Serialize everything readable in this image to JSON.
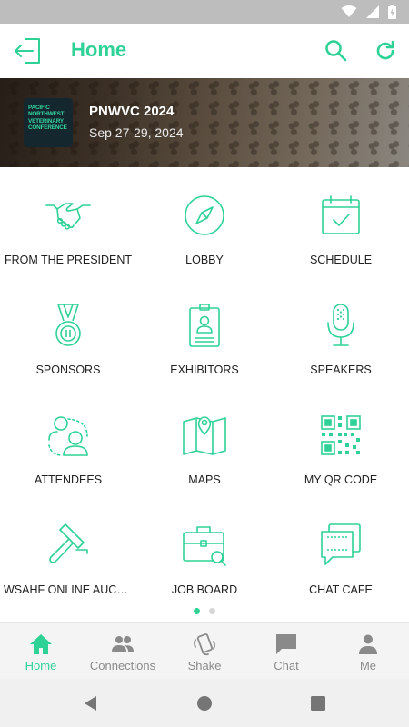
{
  "colors": {
    "accent": "#2ed296",
    "text": "#212121",
    "muted": "#8a8a8a"
  },
  "header": {
    "title": "Home"
  },
  "banner": {
    "logo_lines": [
      "PACIFIC",
      "NORTHWEST",
      "VETERINARY",
      "CONFERENCE"
    ],
    "event_name": "PNWVC 2024",
    "event_dates": "Sep 27-29, 2024"
  },
  "tiles": [
    {
      "label": "FROM THE PRESIDENT",
      "icon": "handshake-icon"
    },
    {
      "label": "LOBBY",
      "icon": "compass-icon"
    },
    {
      "label": "SCHEDULE",
      "icon": "calendar-check-icon"
    },
    {
      "label": "SPONSORS",
      "icon": "medal-icon"
    },
    {
      "label": "EXHIBITORS",
      "icon": "badge-icon"
    },
    {
      "label": "SPEAKERS",
      "icon": "microphone-icon"
    },
    {
      "label": "ATTENDEES",
      "icon": "people-icon"
    },
    {
      "label": "MAPS",
      "icon": "map-pin-icon"
    },
    {
      "label": "MY QR CODE",
      "icon": "qr-code-icon"
    },
    {
      "label": "WSAHF ONLINE AUCTI...",
      "icon": "gavel-icon"
    },
    {
      "label": "JOB BOARD",
      "icon": "briefcase-search-icon"
    },
    {
      "label": "CHAT CAFE",
      "icon": "chat-bubbles-icon"
    }
  ],
  "pager": {
    "pages": 2,
    "current": 1
  },
  "bottom_nav": [
    {
      "label": "Home",
      "icon": "home-icon",
      "active": true
    },
    {
      "label": "Connections",
      "icon": "connections-icon",
      "active": false
    },
    {
      "label": "Shake",
      "icon": "shake-phone-icon",
      "active": false
    },
    {
      "label": "Chat",
      "icon": "chat-icon",
      "active": false
    },
    {
      "label": "Me",
      "icon": "person-icon",
      "active": false
    }
  ]
}
